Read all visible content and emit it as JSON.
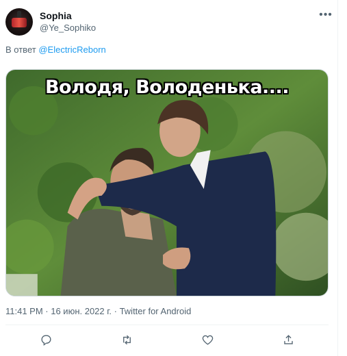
{
  "tweet": {
    "author_name": "Sophia",
    "author_handle": "@Ye_Sophiko",
    "more_icon": "more-horizontal-icon",
    "reply_prefix": "В ответ",
    "reply_mention": "@ElectricReborn",
    "image_caption": "Володя, Володенька....",
    "timestamp": "11:41 PM · 16 июн. 2022 г. · Twitter for Android"
  },
  "actions": [
    {
      "icon": "reply-icon"
    },
    {
      "icon": "retweet-icon"
    },
    {
      "icon": "like-icon"
    },
    {
      "icon": "share-icon"
    }
  ],
  "colors": {
    "accent": "#1d9bf0",
    "secondary_text": "#536471",
    "border": "#cfd9de"
  }
}
